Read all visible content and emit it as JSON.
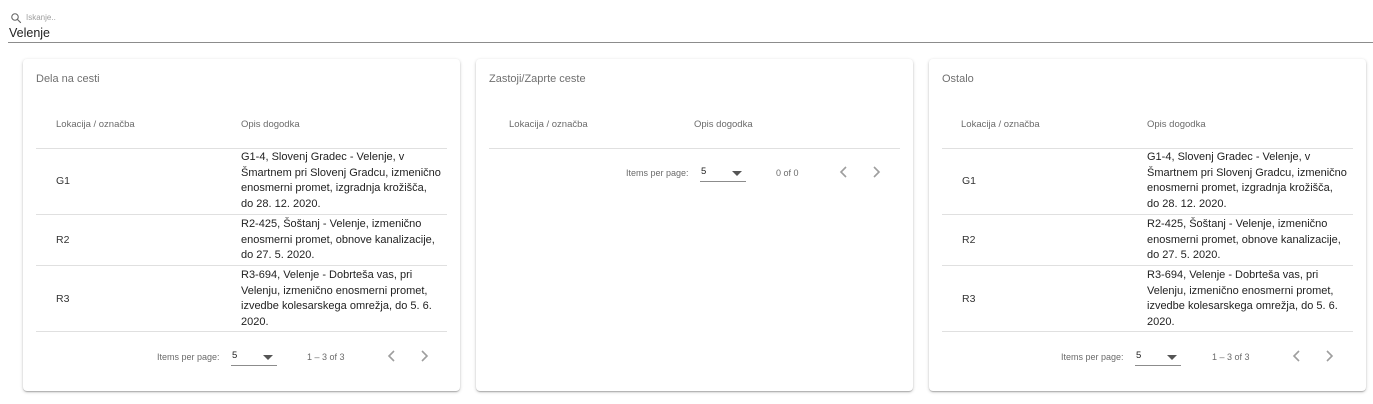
{
  "search": {
    "placeholder": "Iskanje..",
    "value": "Velenje",
    "icon": "search-icon"
  },
  "columns": {
    "location": "Lokacija / označba",
    "description": "Opis dogodka"
  },
  "pager": {
    "items_per_page_label": "Items per page:",
    "page_size": "5"
  },
  "panels": [
    {
      "title": "Dela na cesti",
      "range": "1 – 3 of 3",
      "rows": [
        {
          "loc": "G1",
          "desc": "G1-4, Slovenj Gradec - Velenje, v Šmartnem pri Slovenj Gradcu, izmenično enosmerni promet, izgradnja krožišča, do 28. 12. 2020."
        },
        {
          "loc": "R2",
          "desc": "R2-425, Šoštanj - Velenje, izmenično enosmerni promet, obnove kanalizacije, do 27. 5. 2020."
        },
        {
          "loc": "R3",
          "desc": "R3-694, Velenje - Dobrteša vas, pri Velenju, izmenično enosmerni promet, izvedbe kolesarskega omrežja, do 5. 6. 2020."
        }
      ]
    },
    {
      "title": "Zastoji/Zaprte ceste",
      "range": "0 of 0",
      "rows": []
    },
    {
      "title": "Ostalo",
      "range": "1 – 3 of 3",
      "rows": [
        {
          "loc": "G1",
          "desc": "G1-4, Slovenj Gradec - Velenje, v Šmartnem pri Slovenj Gradcu, izmenično enosmerni promet, izgradnja krožišča, do 28. 12. 2020."
        },
        {
          "loc": "R2",
          "desc": "R2-425, Šoštanj - Velenje, izmenično enosmerni promet, obnove kanalizacije, do 27. 5. 2020."
        },
        {
          "loc": "R3",
          "desc": "R3-694, Velenje - Dobrteša vas, pri Velenju, izmenično enosmerni promet, izvedbe kolesarskega omrežja, do 5. 6. 2020."
        }
      ]
    }
  ]
}
